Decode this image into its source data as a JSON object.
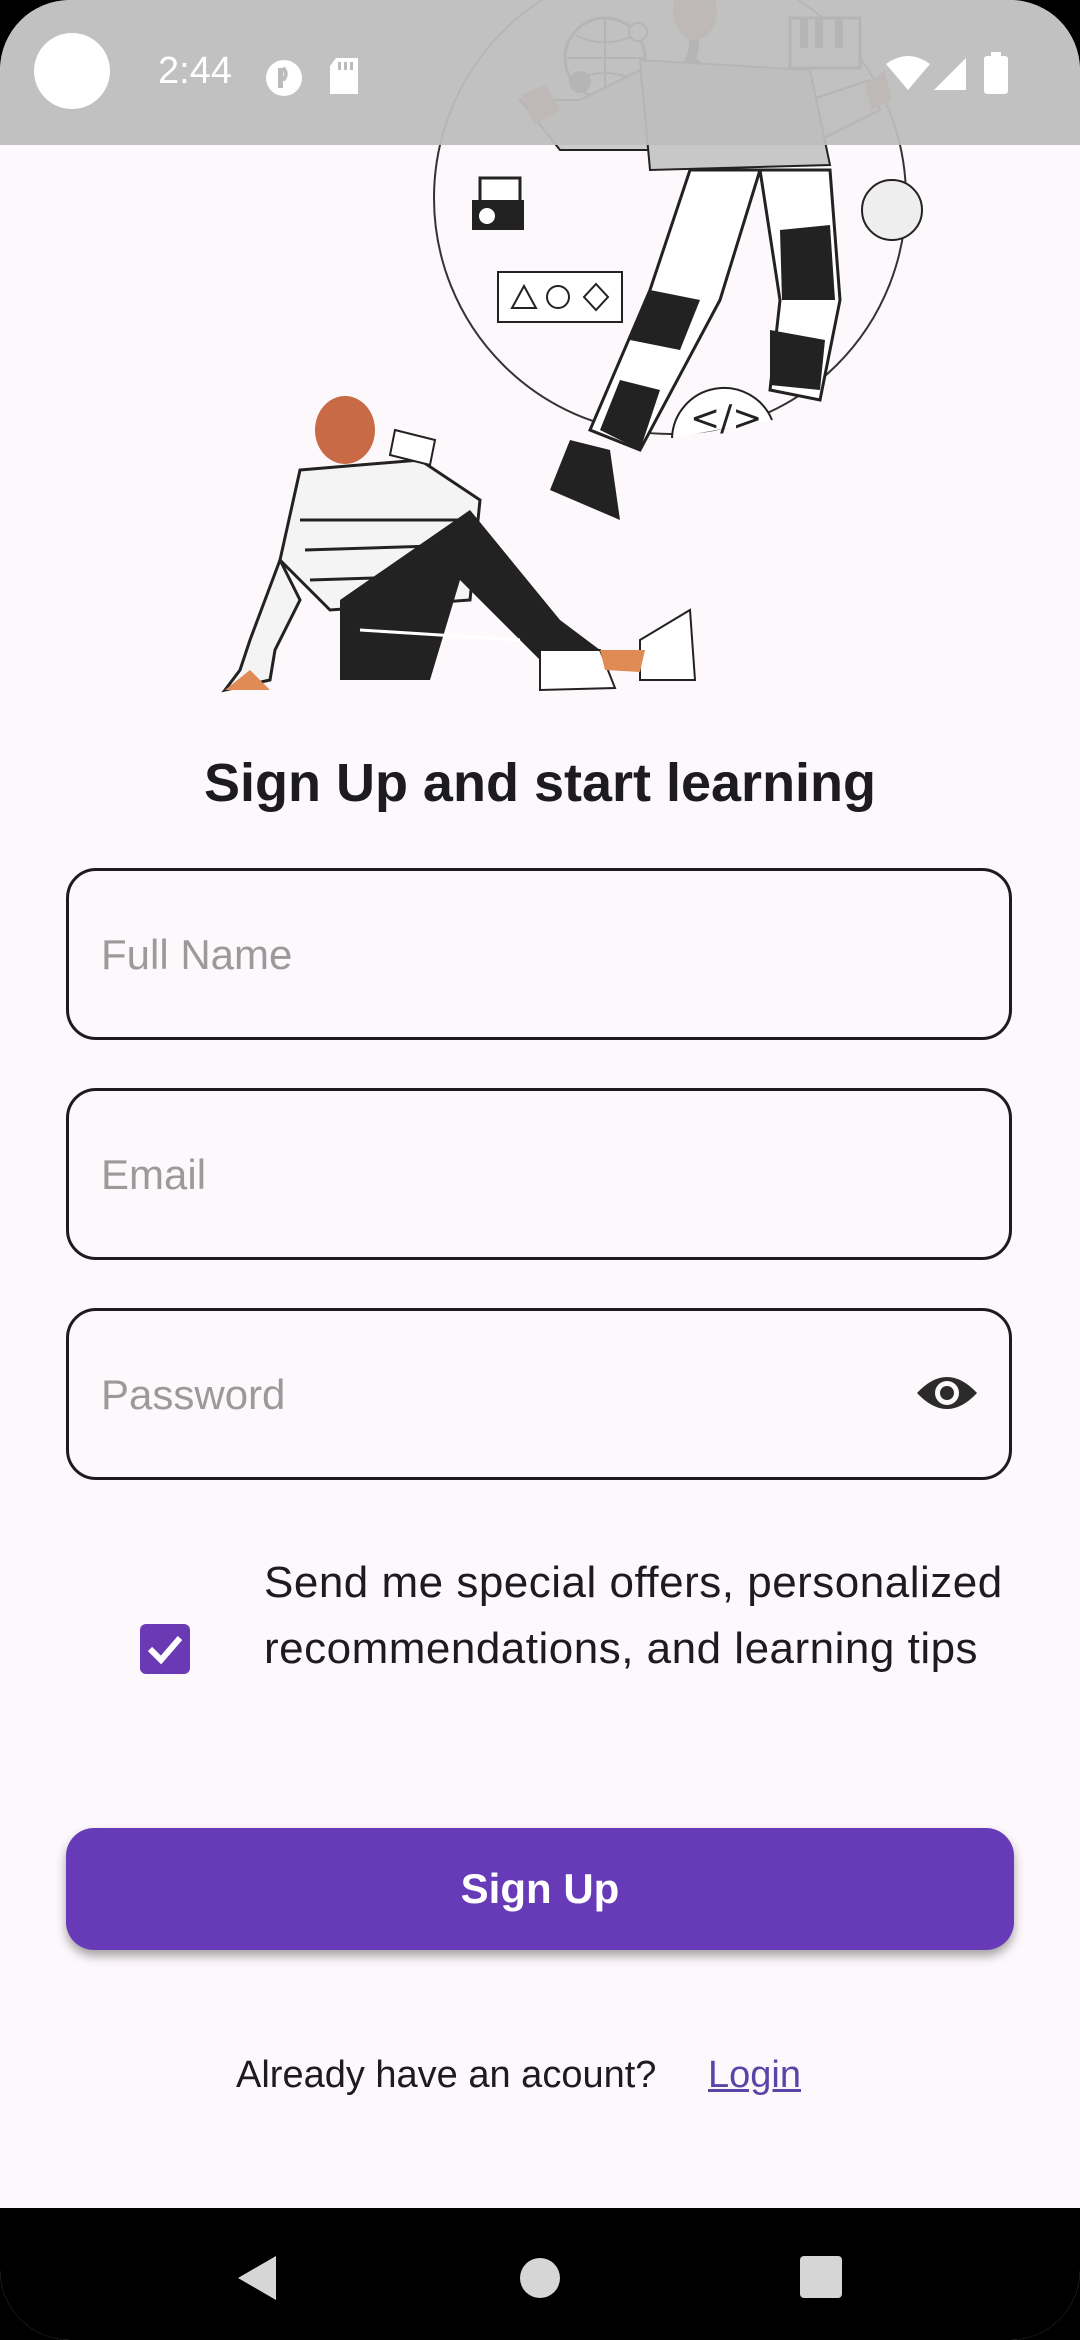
{
  "status_bar": {
    "time": "2:44",
    "icons": [
      "camera-cutout",
      "app-notification-icon",
      "sd-card-icon",
      "wifi-icon",
      "signal-icon",
      "battery-icon"
    ]
  },
  "illustration": {
    "description_icons": [
      "globe-icon",
      "piano-icon",
      "camera-icon",
      "shapes-icon",
      "code-icon"
    ]
  },
  "form": {
    "title": "Sign Up and start learning",
    "full_name_placeholder": "Full Name",
    "email_placeholder": "Email",
    "password_placeholder": "Password",
    "offers_text": "Send me special offers, personalized recommendations, and learning tips",
    "offers_checked": true,
    "signup_label": "Sign Up"
  },
  "footer": {
    "prompt": "Already have an acount?",
    "login_label": "Login"
  },
  "colors": {
    "primary": "#673ab7",
    "background": "#fdf8fc",
    "text": "#1c1b1f"
  },
  "nav_bar": {
    "icons": [
      "back-icon",
      "home-icon",
      "recents-icon"
    ]
  }
}
